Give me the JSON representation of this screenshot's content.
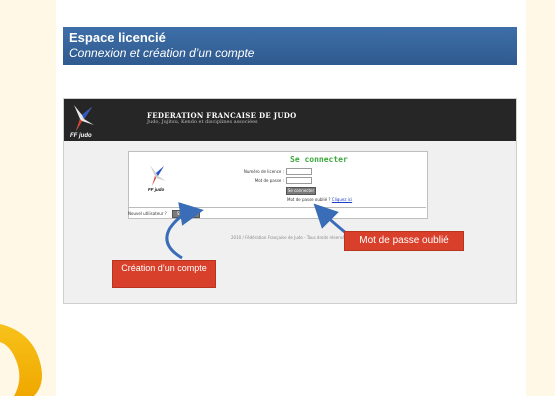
{
  "banner": {
    "title": "Espace licencié",
    "subtitle": "Connexion et création d’un compte"
  },
  "site": {
    "title": "FEDERATION FRANCAISE DE JUDO",
    "subtitle": "Judo, Jujitsu, Kendo et disciplines associées",
    "logo_text": "FF judo"
  },
  "login": {
    "heading": "Se connecter",
    "licence_label": "Numéro de licence :",
    "password_label": "Mot de passe :",
    "submit_label": "Se connecter",
    "forgot_text": "Mot de passe oublié ?",
    "forgot_link": "Cliquez ici",
    "new_user_label": "Nouvel utilisateur ?",
    "register_label": "S'inscrire"
  },
  "footer": {
    "text": "2010 / Fédération Française de Judo - Tous droits réservés"
  },
  "callouts": {
    "password": "Mot de passe oublié",
    "create": "Création d’un compte"
  },
  "colors": {
    "banner": "#3467a2",
    "callout": "#d9402b",
    "accent_green": "#3aa83a"
  }
}
